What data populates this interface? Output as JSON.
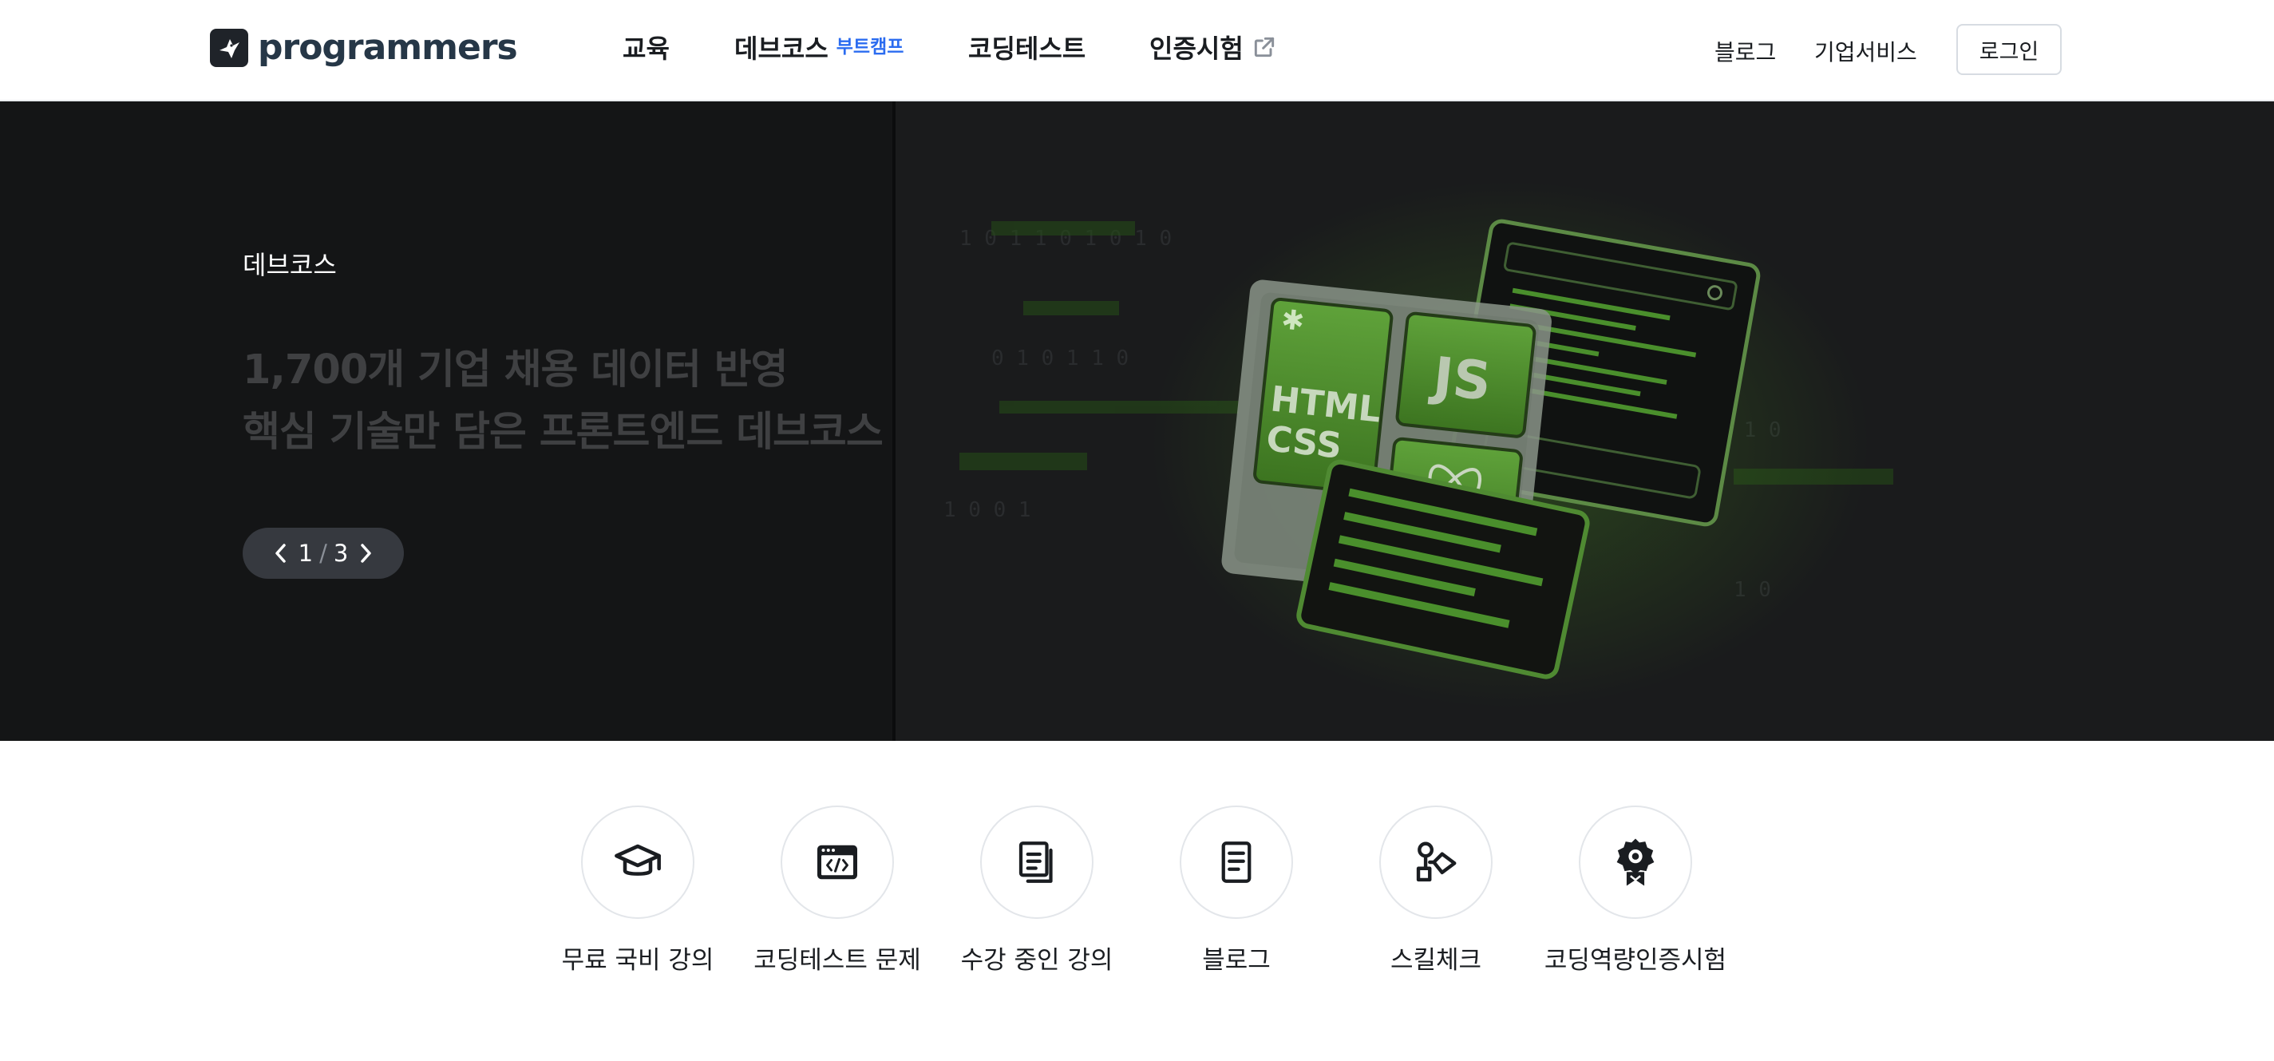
{
  "header": {
    "logo_text": "programmers",
    "nav": [
      {
        "label": "교육"
      },
      {
        "label": "데브코스",
        "badge": "부트캠프"
      },
      {
        "label": "코딩테스트"
      },
      {
        "label": "인증시험",
        "icon": "external-link-icon"
      }
    ],
    "utility": {
      "blog": "블로그",
      "business": "기업서비스"
    },
    "login_label": "로그인"
  },
  "hero": {
    "category": "데브코스",
    "title_line1": "1,700개 기업 채용 데이터 반영",
    "title_line2": "핵심 기술만 담은 프론트엔드 데브코스",
    "pager": {
      "current": "1",
      "separator": "/",
      "total": "3"
    },
    "art_labels": {
      "html": "HTML",
      "css": "CSS",
      "js": "JS"
    }
  },
  "quick_menu": [
    {
      "label": "무료 국비 강의",
      "icon": "graduation-cap-icon"
    },
    {
      "label": "코딩테스트 문제",
      "icon": "code-window-icon"
    },
    {
      "label": "수강 중인 강의",
      "icon": "documents-icon"
    },
    {
      "label": "블로그",
      "icon": "document-icon"
    },
    {
      "label": "스킬체크",
      "icon": "skill-shapes-icon"
    },
    {
      "label": "코딩역량인증시험",
      "icon": "certification-badge-icon"
    }
  ],
  "colors": {
    "accent": "#2b6cf0",
    "hero_bg": "#121314",
    "art_green": "#4a8f2c"
  }
}
